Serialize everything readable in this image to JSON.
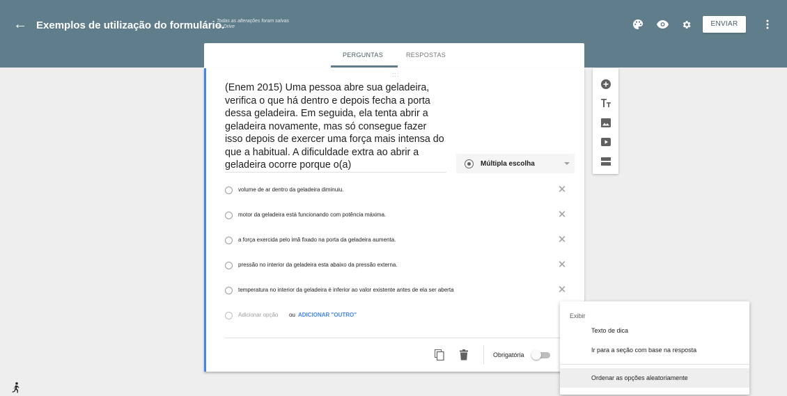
{
  "header": {
    "back_icon": "arrow-back-icon",
    "title": "Exemplos de utilização do formulário.",
    "save_status": "Todas as alterações foram salvas no Drive",
    "icons": [
      "palette-icon",
      "eye-icon",
      "gear-icon",
      "more-vert-icon"
    ],
    "send_label": "ENVIAR",
    "bg_color": "#607d8b"
  },
  "tabs": {
    "perguntas": "PERGUNTAS",
    "respostas": "RESPOSTAS",
    "active": "PERGUNTAS"
  },
  "question": {
    "drag_handle": ":::",
    "text": "(Enem 2015) Uma pessoa abre sua geladeira, verifica o que há dentro e depois fecha a porta dessa geladeira. Em seguida, ela tenta abrir a geladeira novamente, mas só consegue fazer isso depois de exercer uma força mais intensa do que a habitual. A dificuldade extra ao abrir a geladeira ocorre porque o(a)",
    "type": "Múltipla escolha",
    "options": [
      "volume de ar dentro da geladeira diminuiu.",
      "motor da geladeira está funcionando com potência máxima.",
      "a força exercida pelo imã fixado na porta da geladeira aumenta.",
      "pressão no interior da geladeira esta abaixo da pressão externa.",
      "temperatura no interior da geladeira é inferior ao valor existente antes de ela ser aberta"
    ],
    "remove_symbol": "✕",
    "add_option": "Adicionar opção",
    "or": "ou",
    "add_other": "ADICIONAR \"OUTRO\"",
    "required_label": "Obrigatória",
    "required": false,
    "accent_color": "#4285f4"
  },
  "toolbar": {
    "icons": [
      "add-circle-icon",
      "title-icon",
      "image-icon",
      "video-icon",
      "section-icon"
    ]
  },
  "context_menu": {
    "header": "Exibir",
    "items": [
      "Texto de dica",
      "Ir para a seção com base na resposta",
      "Ordenar as opções aleatoriamente"
    ],
    "highlighted": "Ordenar as opções aleatoriamente"
  }
}
